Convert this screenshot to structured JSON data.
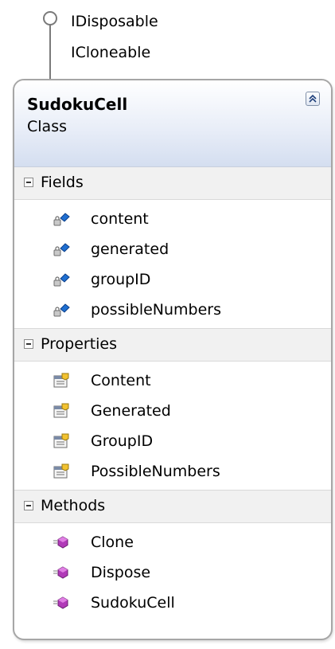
{
  "interfaces": [
    "IDisposable",
    "ICloneable"
  ],
  "class": {
    "name": "SudokuCell",
    "stereotype": "Class"
  },
  "sections": {
    "fields": {
      "label": "Fields",
      "items": [
        "content",
        "generated",
        "groupID",
        "possibleNumbers"
      ]
    },
    "properties": {
      "label": "Properties",
      "items": [
        "Content",
        "Generated",
        "GroupID",
        "PossibleNumbers"
      ]
    },
    "methods": {
      "label": "Methods",
      "items": [
        "Clone",
        "Dispose",
        "SudokuCell"
      ]
    }
  },
  "icons": {
    "field": "private-field-icon",
    "property": "property-icon",
    "method": "method-icon",
    "collapse": "collapse-chevron-icon",
    "interface": "interface-lollipop-icon"
  }
}
